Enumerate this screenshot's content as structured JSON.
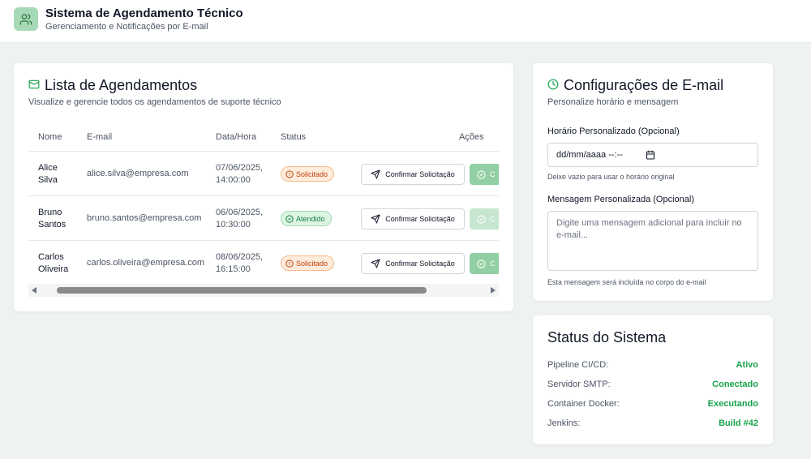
{
  "header": {
    "title": "Sistema de Agendamento Técnico",
    "subtitle": "Gerenciamento e Notificações por E-mail",
    "logo_icon": "users-icon"
  },
  "appointments": {
    "title": "Lista de Agendamentos",
    "description": "Visualize e gerencie todos os agendamentos de suporte técnico",
    "columns": [
      "Nome",
      "E-mail",
      "Data/Hora",
      "Status",
      "Ações"
    ],
    "rows": [
      {
        "name_line1": "Alice",
        "name_line2": "Silva",
        "email": "alice.silva@empresa.com",
        "date": "07/06/2025,",
        "time": "14:00:00",
        "status": "Solicitado",
        "status_type": "pending",
        "confirm_label": "Confirmar Solicitação",
        "check_label": "C"
      },
      {
        "name_line1": "Bruno",
        "name_line2": "Santos",
        "email": "bruno.santos@empresa.com",
        "date": "06/06/2025,",
        "time": "10:30:00",
        "status": "Atendido",
        "status_type": "done",
        "confirm_label": "Confirmar Solicitação",
        "check_label": "C"
      },
      {
        "name_line1": "Carlos",
        "name_line2": "Oliveira",
        "email": "carlos.oliveira@empresa.com",
        "date": "08/06/2025,",
        "time": "16:15:00",
        "status": "Solicitado",
        "status_type": "pending",
        "confirm_label": "Confirmar Solicitação",
        "check_label": "C"
      }
    ]
  },
  "email_config": {
    "title": "Configurações de E-mail",
    "description": "Personalize horário e mensagem",
    "time_label": "Horário Personalizado (Opcional)",
    "time_value": "dd/mm/aaaa --:--",
    "time_hint": "Deixe vazio para usar o horário original",
    "message_label": "Mensagem Personalizada (Opcional)",
    "message_placeholder": "Digite uma mensagem adicional para incluir no e-mail...",
    "message_hint": "Esta mensagem será incluída no corpo do e-mail"
  },
  "system_status": {
    "title": "Status do Sistema",
    "items": [
      {
        "label": "Pipeline CI/CD:",
        "value": "Ativo"
      },
      {
        "label": "Servidor SMTP:",
        "value": "Conectado"
      },
      {
        "label": "Container Docker:",
        "value": "Executando"
      },
      {
        "label": "Jenkins:",
        "value": "Build #42"
      }
    ]
  },
  "colors": {
    "accent": "#16a34a",
    "background": "#eef3ef",
    "pending": "#c2410c",
    "done": "#15803d"
  }
}
